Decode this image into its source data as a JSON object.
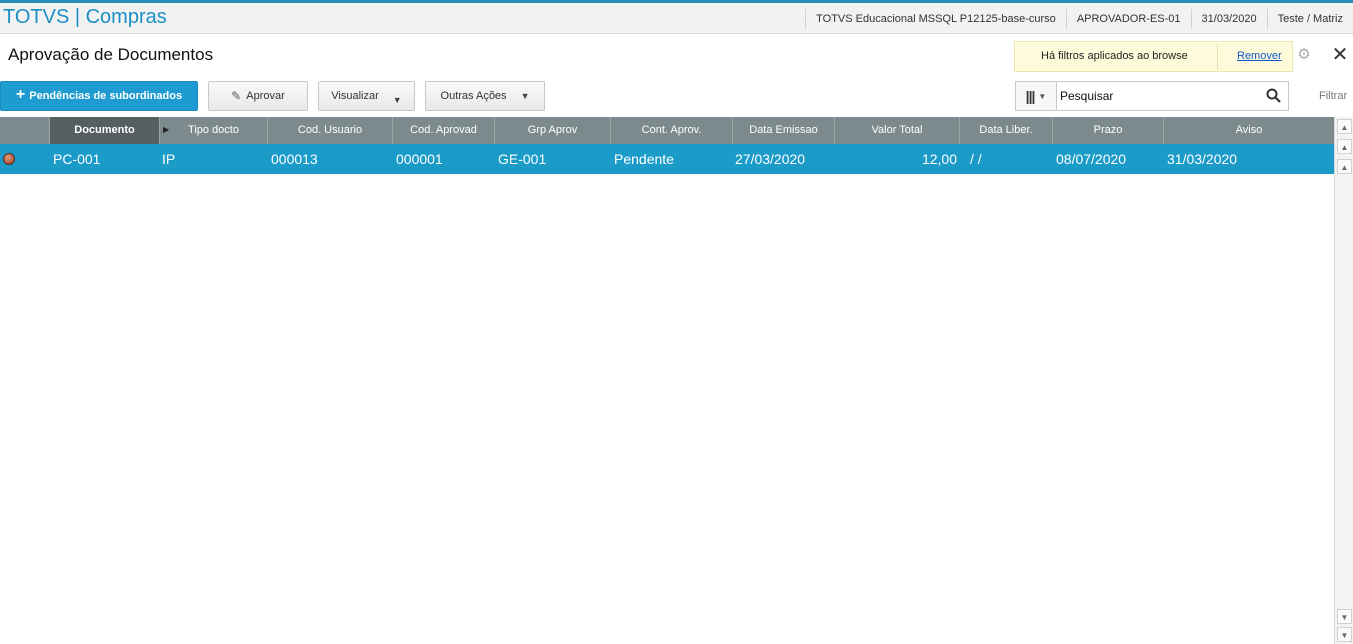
{
  "app": {
    "title": "TOTVS | Compras",
    "env": "TOTVS Educacional MSSQL P12125-base-curso",
    "user": "APROVADOR-ES-01",
    "date": "31/03/2020",
    "branch": "Teste / Matriz"
  },
  "page": {
    "title": "Aprovação de Documentos"
  },
  "filter_notice": {
    "text": "Há filtros aplicados ao browse",
    "remove_label": "Remover"
  },
  "toolbar": {
    "pendencias_label": "Pendências de subordinados",
    "aprovar_label": "Aprovar",
    "visualizar_label": "Visualizar",
    "outras_label": "Outras Ações"
  },
  "search": {
    "placeholder": "Pesquisar",
    "filter_label": "Filtrar"
  },
  "table": {
    "columns": [
      "Documento",
      "Tipo docto",
      "Cod. Usuario",
      "Cod. Aprovad",
      "Grp Aprov",
      "Cont. Aprov.",
      "Data Emissao",
      "Valor Total",
      "Data Liber.",
      "Prazo",
      "Aviso"
    ],
    "rows": [
      {
        "documento": "PC-001",
        "tipo": "IP",
        "cod_usuario": "000013",
        "cod_aprovad": "000001",
        "grp_aprov": "GE-001",
        "cont_aprov": "Pendente",
        "data_emissao": "27/03/2020",
        "valor_total": "12,00",
        "data_liber": "/  /",
        "prazo": "08/07/2020",
        "aviso": "31/03/2020"
      }
    ]
  },
  "colors": {
    "accent": "#1a9bc8",
    "header_bg": "#7d8a8d",
    "title_blue": "#1a8fc4"
  }
}
